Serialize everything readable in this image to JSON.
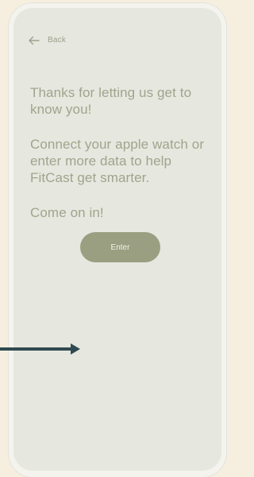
{
  "nav": {
    "back_label": "Back",
    "back_icon": "arrow-left-icon"
  },
  "main": {
    "line_1": "Thanks for letting us get to know you!",
    "line_2": "Connect your apple watch or enter more data to help FitCast get smarter.",
    "line_3": "Come on in!",
    "enter_label": "Enter"
  },
  "colors": {
    "background": "#f6efdf",
    "panel": "#e6e7df",
    "text": "#9fa58c",
    "button": "#9b9f81",
    "button_text": "#f3f2ea",
    "arrow": "#2f4a4f"
  },
  "annotation": {
    "icon": "arrow-right-icon"
  }
}
